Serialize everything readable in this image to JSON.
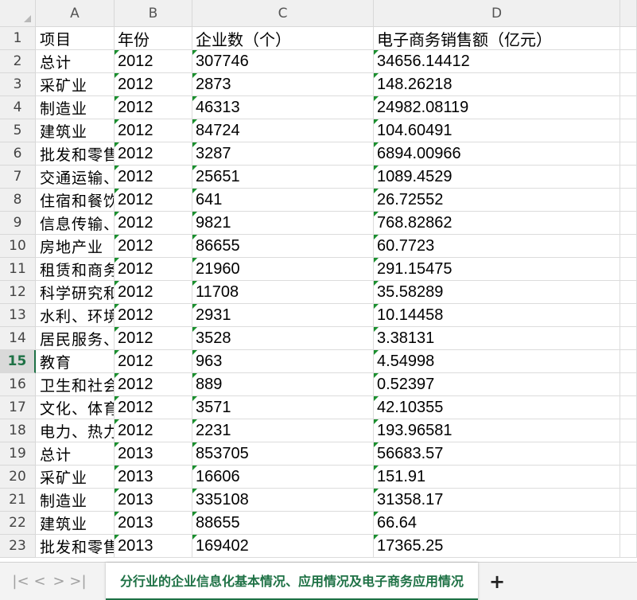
{
  "columns": [
    "A",
    "B",
    "C",
    "D"
  ],
  "rows": [
    {
      "n": "1",
      "a": "项目",
      "b": "年份",
      "c": "企业数（个）",
      "d": "电子商务销售额（亿元）",
      "flag": false
    },
    {
      "n": "2",
      "a": "总计",
      "b": "2012",
      "c": "307746",
      "d": "34656.14412",
      "flag": true
    },
    {
      "n": "3",
      "a": "采矿业",
      "b": "2012",
      "c": "2873",
      "d": "148.26218",
      "flag": true
    },
    {
      "n": "4",
      "a": "制造业",
      "b": "2012",
      "c": "46313",
      "d": "24982.08119",
      "flag": true
    },
    {
      "n": "5",
      "a": "建筑业",
      "b": "2012",
      "c": "84724",
      "d": "104.60491",
      "flag": true
    },
    {
      "n": "6",
      "a": "批发和零售",
      "b": "2012",
      "c": "3287",
      "d": "6894.00966",
      "flag": true
    },
    {
      "n": "7",
      "a": "交通运输、",
      "b": "2012",
      "c": "25651",
      "d": "1089.4529",
      "flag": true
    },
    {
      "n": "8",
      "a": "住宿和餐饮",
      "b": "2012",
      "c": "641",
      "d": "26.72552",
      "flag": true
    },
    {
      "n": "9",
      "a": "信息传输、",
      "b": "2012",
      "c": "9821",
      "d": "768.82862",
      "flag": true
    },
    {
      "n": "10",
      "a": "房地产业",
      "b": "2012",
      "c": "86655",
      "d": "60.7723",
      "flag": true
    },
    {
      "n": "11",
      "a": "租赁和商务",
      "b": "2012",
      "c": "21960",
      "d": "291.15475",
      "flag": true
    },
    {
      "n": "12",
      "a": "科学研究和",
      "b": "2012",
      "c": "11708",
      "d": "35.58289",
      "flag": true
    },
    {
      "n": "13",
      "a": "水利、环境",
      "b": "2012",
      "c": "2931",
      "d": "10.14458",
      "flag": true
    },
    {
      "n": "14",
      "a": "居民服务、",
      "b": "2012",
      "c": "3528",
      "d": "3.38131",
      "flag": true
    },
    {
      "n": "15",
      "a": "教育",
      "b": "2012",
      "c": "963",
      "d": "4.54998",
      "flag": true
    },
    {
      "n": "16",
      "a": "卫生和社会",
      "b": "2012",
      "c": "889",
      "d": "0.52397",
      "flag": true
    },
    {
      "n": "17",
      "a": "文化、体育",
      "b": "2012",
      "c": "3571",
      "d": "42.10355",
      "flag": true
    },
    {
      "n": "18",
      "a": "电力、热力",
      "b": "2012",
      "c": "2231",
      "d": "193.96581",
      "flag": true
    },
    {
      "n": "19",
      "a": "总计",
      "b": "2013",
      "c": "853705",
      "d": "56683.57",
      "flag": true
    },
    {
      "n": "20",
      "a": "采矿业",
      "b": "2013",
      "c": "16606",
      "d": "151.91",
      "flag": true
    },
    {
      "n": "21",
      "a": "制造业",
      "b": "2013",
      "c": "335108",
      "d": "31358.17",
      "flag": true
    },
    {
      "n": "22",
      "a": "建筑业",
      "b": "2013",
      "c": "88655",
      "d": "66.64",
      "flag": true
    },
    {
      "n": "23",
      "a": "批发和零售",
      "b": "2013",
      "c": "169402",
      "d": "17365.25",
      "flag": true
    }
  ],
  "active_row": "15",
  "sheet_nav": {
    "first": "|<",
    "prev": "<",
    "next": ">",
    "last": ">|"
  },
  "sheet_tab_label": "分行业的企业信息化基本情况、应用情况及电子商务应用情况",
  "add_sheet_label": "+",
  "colors": {
    "accent": "#1e7145",
    "error_flag": "#1a8f2e"
  }
}
